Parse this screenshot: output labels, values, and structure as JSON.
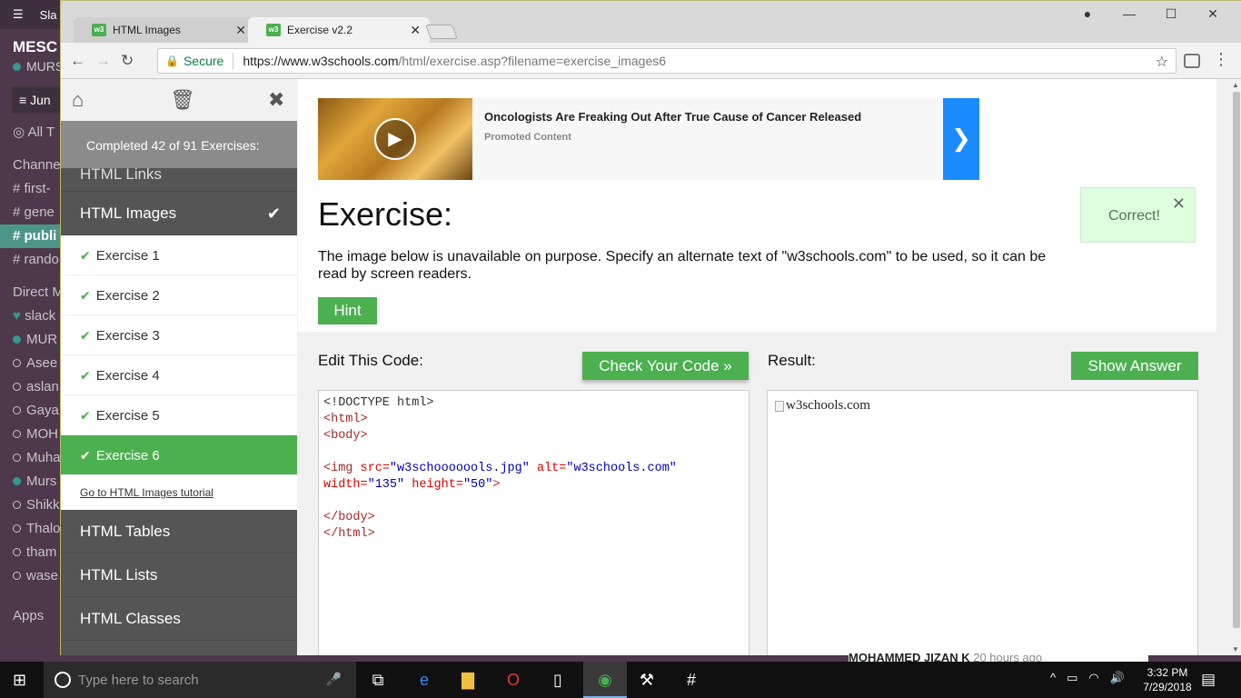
{
  "slack": {
    "title": "Sla",
    "workspace": "MESC",
    "user": "MURS",
    "jump": "Jun",
    "all_threads": "All T",
    "channels_header": "Channe",
    "channels": [
      "first-",
      "gene",
      "publi",
      "rando"
    ],
    "dm_header": "Direct M",
    "dms": [
      "slack",
      "MUR",
      "Asee",
      "aslan",
      "Gaya",
      "MOH",
      "Muha",
      "Murs",
      "Shikk",
      "Thalo",
      "tham",
      "wase"
    ],
    "apps": "Apps"
  },
  "browser": {
    "tabs": [
      {
        "label": "HTML Images",
        "favicon": "w3"
      },
      {
        "label": "Exercise v2.2",
        "favicon": "w3"
      }
    ],
    "secure_label": "Secure",
    "url_base": "https://www.w3schools.com",
    "url_path": "/html/exercise.asp?filename=exercise_images6"
  },
  "exercise_menu": {
    "completed": "Completed 42 of 91 Exercises:",
    "prev_category": "HTML Links",
    "current_category": "HTML Images",
    "exercises": [
      "Exercise 1",
      "Exercise 2",
      "Exercise 3",
      "Exercise 4",
      "Exercise 5",
      "Exercise 6"
    ],
    "tutorial_link": "Go to HTML Images tutorial",
    "next_categories": [
      "HTML Tables",
      "HTML Lists",
      "HTML Classes"
    ]
  },
  "ad": {
    "headline": "Oncologists Are Freaking Out After True Cause of Cancer Released",
    "sponsor": "Promoted Content"
  },
  "exercise": {
    "title": "Exercise:",
    "correct": "Correct!",
    "instructions": "The image below is unavailable on purpose. Specify an alternate text of \"w3schools.com\" to be used, so it can be read by screen readers.",
    "hint": "Hint",
    "edit_label": "Edit This Code:",
    "check_button": "Check Your Code »",
    "result_label": "Result:",
    "answer_button": "Show Answer",
    "code": {
      "doctype": "<!DOCTYPE html>",
      "html_open": "<html>",
      "body_open": "<body>",
      "img_tag": "<img",
      "src_attr": "src=",
      "src_val": "\"w3schooooools.jpg\"",
      "alt_attr": "alt=",
      "alt_val": "\"w3schools.com\"",
      "width_attr": "width=",
      "width_val": "\"135\"",
      "height_attr": "height=",
      "height_val": "\"50\"",
      "tag_close": ">",
      "body_close": "</body>",
      "html_close": "</html>"
    },
    "result_alt": "w3schools.com"
  },
  "slack_message": "MOHAMMED JIZAN K",
  "slack_message_time": "20 hours ago",
  "taskbar": {
    "search_placeholder": "Type here to search",
    "time": "3:32 PM",
    "date": "7/29/2018"
  }
}
